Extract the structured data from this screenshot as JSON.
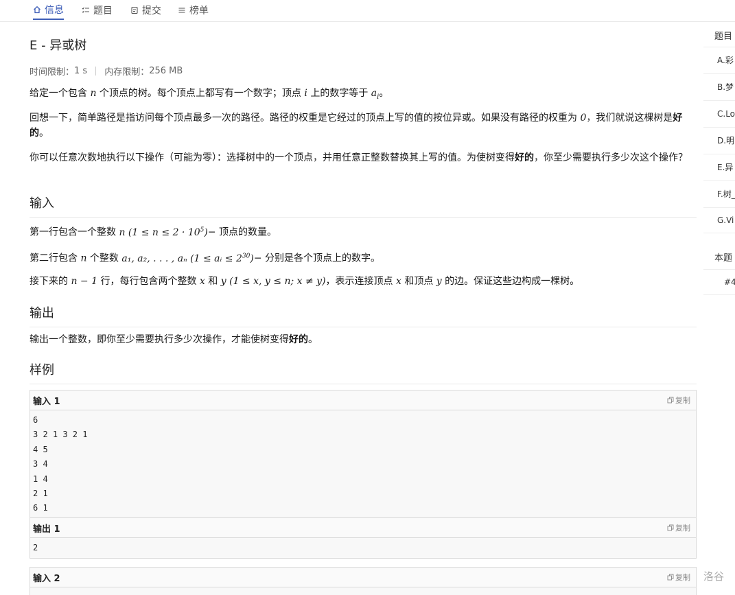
{
  "nav": {
    "tabs": [
      {
        "label": "信息",
        "icon": "home-icon"
      },
      {
        "label": "题目",
        "icon": "list-check-icon"
      },
      {
        "label": "提交",
        "icon": "document-icon"
      },
      {
        "label": "榜单",
        "icon": "list-icon"
      }
    ]
  },
  "problem": {
    "title": "E - 异或树",
    "time_label": "时间限制：",
    "time_value": "1 s",
    "memory_label": "内存限制：",
    "memory_value": "256 MB",
    "p1": {
      "a": "给定一个包含 ",
      "v1": "n",
      "b": " 个顶点的树。每个顶点上都写有一个数字；顶点 ",
      "v2": "i",
      "c": " 上的数字等于 ",
      "v3": "a",
      "v3sub": "i",
      "d": "。"
    },
    "p2": {
      "a": "回想一下，简单路径是指访问每个顶点最多一次的路径。路径的权重是它经过的顶点上写的值的按位异或。如果没有路径的权重为 ",
      "v1": "0",
      "b": "，我们就说这棵树是",
      "bold": "好的",
      "c": "。"
    },
    "p3": {
      "a": "你可以任意次数地执行以下操作（可能为零）：选择树中的一个顶点，并用任意正整数替换其上写的值。为使树变得",
      "bold": "好的",
      "b": "，你至少需要执行多少次这个操作？"
    },
    "input_heading": "输入",
    "in1": {
      "a": "第一行包含一个整数 ",
      "formula": "n (1 ≤ n ≤ 2 · 10",
      "sup": "5",
      "close": ")",
      "b": "− 顶点的数量。"
    },
    "in2": {
      "a": "第二行包含 ",
      "v1": "n",
      "b": " 个整数 ",
      "formula": "a₁, a₂, . . . , aₙ (1 ≤ aᵢ ≤ 2",
      "sup": "30",
      "close": ")",
      "c": "− 分别是各个顶点上的数字。"
    },
    "in3": {
      "a": "接下来的 ",
      "f1": "n − 1",
      "b": " 行，每行包含两个整数 ",
      "v1": "x",
      "c": " 和 ",
      "v2": "y",
      "f2": "(1 ≤ x, y ≤ n;  x ≠ y)",
      "d": "，表示连接顶点 ",
      "v3": "x",
      "e": " 和顶点 ",
      "v4": "y",
      "f": " 的边。保证这些边构成一棵树。"
    },
    "output_heading": "输出",
    "out1": {
      "a": "输出一个整数，即你至少需要执行多少次操作，才能使树变得",
      "bold": "好的",
      "b": "。"
    },
    "samples_heading": "样例",
    "copy_label": "复制",
    "samples": [
      {
        "label": "输入 1",
        "content": "6\n3 2 1 3 2 1\n4 5\n3 4\n1 4\n2 1\n6 1"
      },
      {
        "label": "输出 1",
        "content": "2"
      },
      {
        "label": "输入 2",
        "content": ""
      }
    ]
  },
  "sidebar": {
    "title": "题目",
    "items": [
      "A.彩",
      "B.梦",
      "C.Lo",
      "D.明",
      "E.异",
      "F.树_",
      "G.Vi"
    ],
    "section2": "本题",
    "section2_item": "#4"
  },
  "watermark": "洛谷"
}
